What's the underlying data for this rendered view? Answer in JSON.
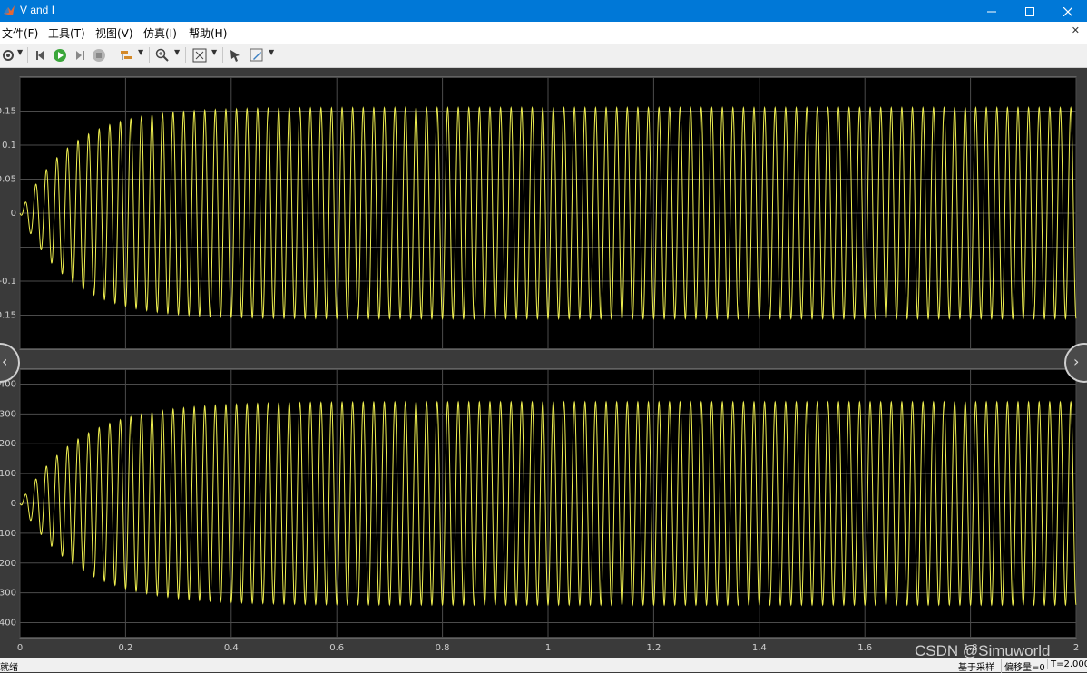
{
  "window": {
    "title": "V and I"
  },
  "menu": [
    "文件(F)",
    "工具(T)",
    "视图(V)",
    "仿真(I)",
    "帮助(H)"
  ],
  "toolbar": {
    "icons": [
      "settings-icon",
      "step-back-icon",
      "run-icon",
      "step-forward-icon",
      "stop-icon",
      "highlight-icon",
      "zoom-icon",
      "fit-icon",
      "cursor-icon",
      "edit-icon"
    ]
  },
  "status": {
    "left": "就绪",
    "sample": "基于采样",
    "offset": "偏移量=0",
    "time": "T=2.000"
  },
  "watermark": "CSDN @Simuworld",
  "colors": {
    "signal": "#f0f050",
    "grid": "#4b4b4b",
    "axes": "#000000",
    "figure": "#3a3a3a",
    "tick": "#cfcfcf"
  },
  "chart_data": [
    {
      "type": "line",
      "xlim": [
        0,
        2
      ],
      "ylim": [
        -0.2,
        0.2
      ],
      "xticks": [
        "0",
        "0.2",
        "0.4",
        "0.6",
        "0.8",
        "1",
        "1.2",
        "1.4",
        "1.6",
        "1.8",
        "2"
      ],
      "yticks": [
        "0.15",
        "0.1",
        "0.05",
        "0",
        "-0.1",
        "0.15"
      ],
      "series": [
        {
          "amplitude": 0.155,
          "frequency_hz": 50,
          "settle_time": 0.3
        }
      ],
      "grid": true
    },
    {
      "type": "line",
      "xlim": [
        0,
        2
      ],
      "ylim": [
        -450,
        450
      ],
      "xticks": [
        "0",
        "0.2",
        "0.4",
        "0.6",
        "0.8",
        "1",
        "1.2",
        "1.4",
        "1.6",
        "1.8",
        "2"
      ],
      "yticks": [
        "400",
        "300",
        "200",
        "100",
        "0",
        "100",
        "200",
        "300",
        "400"
      ],
      "series": [
        {
          "amplitude": 340,
          "frequency_hz": 50,
          "settle_time": 0.35
        }
      ],
      "grid": true
    }
  ]
}
